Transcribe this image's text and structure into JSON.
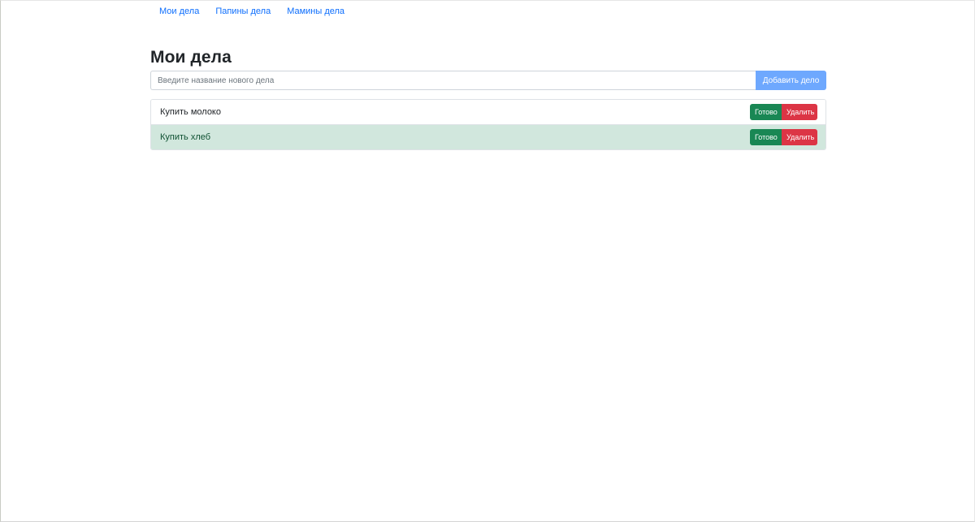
{
  "nav": {
    "links": [
      {
        "label": "Мои дела"
      },
      {
        "label": "Папины дела"
      },
      {
        "label": "Мамины дела"
      }
    ]
  },
  "page": {
    "title": "Мои дела"
  },
  "new_task": {
    "placeholder": "Введите название нового дела",
    "value": "",
    "add_label": "Добавить дело"
  },
  "tasks": [
    {
      "text": "Купить молоко",
      "done": false,
      "ready_label": "Готово",
      "delete_label": "Удалить"
    },
    {
      "text": "Купить хлеб",
      "done": true,
      "ready_label": "Готово",
      "delete_label": "Удалить"
    }
  ],
  "colors": {
    "link": "#0d6efd",
    "add_button": "#6ea8fe",
    "ready_button": "#198754",
    "delete_button": "#dc3545",
    "done_row": "#d1e7dd"
  }
}
